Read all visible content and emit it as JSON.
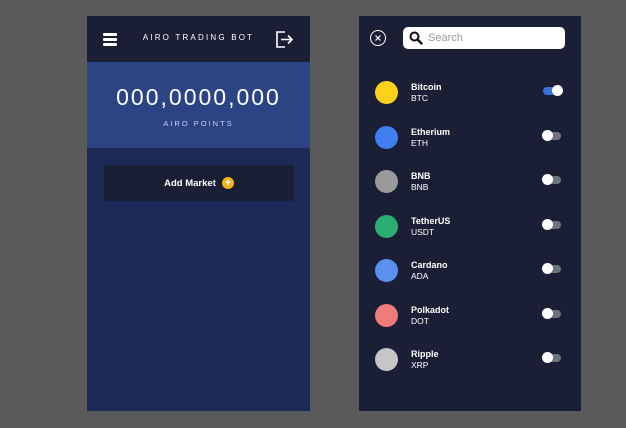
{
  "app": {
    "title": "AIRO TRADING BOT",
    "points_value": "000,0000,000",
    "points_label": "AIRO POINTS",
    "add_market_label": "Add Market"
  },
  "search": {
    "placeholder": "Search",
    "value": ""
  },
  "coins": [
    {
      "name": "Bitcoin",
      "ticker": "BTC",
      "color": "#ffd11a",
      "enabled": true
    },
    {
      "name": "Etherium",
      "ticker": "ETH",
      "color": "#3f7ff0",
      "enabled": false
    },
    {
      "name": "BNB",
      "ticker": "BNB",
      "color": "#9a9a9a",
      "enabled": false
    },
    {
      "name": "TetherUS",
      "ticker": "USDT",
      "color": "#2aae73",
      "enabled": false
    },
    {
      "name": "Cardano",
      "ticker": "ADA",
      "color": "#5a90f0",
      "enabled": false
    },
    {
      "name": "Polkadot",
      "ticker": "DOT",
      "color": "#f07b7b",
      "enabled": false
    },
    {
      "name": "Ripple",
      "ticker": "XRP",
      "color": "#c6c6c6",
      "enabled": false
    }
  ],
  "colors": {
    "accent": "#2c4484",
    "toggle_on": "#3c6fd8",
    "plus": "#f2b21b"
  },
  "icons": {
    "menu": "hamburger-menu-icon",
    "exit": "logout-icon",
    "add": "plus-circle-icon",
    "close": "close-icon",
    "search": "search-icon"
  }
}
